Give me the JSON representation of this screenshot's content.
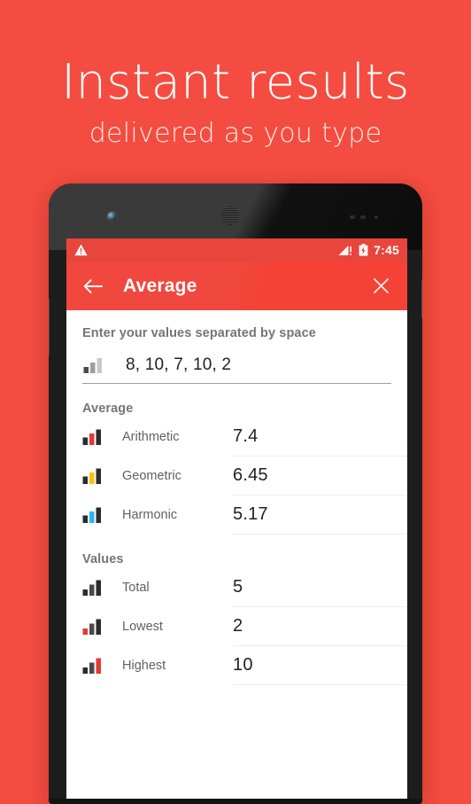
{
  "promo": {
    "title": "Instant results",
    "subtitle": "delivered as you type",
    "background_color": "#f44c40"
  },
  "device": {
    "camera_icon": "front-camera-icon",
    "speaker_icon": "earpiece-speaker-icon",
    "volume_button": "volume-rocker",
    "power_button": "power-button"
  },
  "statusbar": {
    "warning_icon": "warning-triangle-icon",
    "signal_icon": "signal-bars-icon",
    "battery_icon": "battery-charging-icon",
    "time": "7:45",
    "background_color": "#e8453c"
  },
  "appbar": {
    "back_icon": "back-arrow-icon",
    "title": "Average",
    "close_icon": "close-icon",
    "background_color": "#f44336"
  },
  "input": {
    "label": "Enter your values separated by space",
    "icon": "bar-chart-icon",
    "value": "8, 10, 7, 10, 2",
    "placeholder": "Enter your values separated by space"
  },
  "sections": [
    {
      "heading": "Average",
      "rows": [
        {
          "icon": "bar-chart-red-middle-icon",
          "label": "Arithmetic",
          "value": "7.4",
          "accent": "#e53935"
        },
        {
          "icon": "bar-chart-amber-middle-icon",
          "label": "Geometric",
          "value": "6.45",
          "accent": "#ffc107"
        },
        {
          "icon": "bar-chart-blue-middle-icon",
          "label": "Harmonic",
          "value": "5.17",
          "accent": "#29b6f6"
        }
      ]
    },
    {
      "heading": "Values",
      "rows": [
        {
          "icon": "bar-chart-dark-icon",
          "label": "Total",
          "value": "5",
          "accent": "#3a3a3a"
        },
        {
          "icon": "bar-chart-red-first-icon",
          "label": "Lowest",
          "value": "2",
          "accent": "#e53935"
        },
        {
          "icon": "bar-chart-red-last-icon",
          "label": "Highest",
          "value": "10",
          "accent": "#e53935"
        }
      ]
    }
  ]
}
